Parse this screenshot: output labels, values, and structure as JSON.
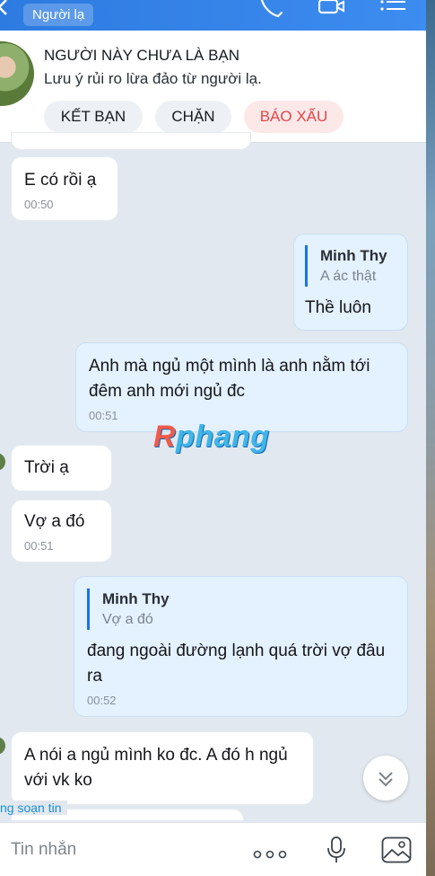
{
  "header": {
    "tag": "Người lạ"
  },
  "stranger_card": {
    "title": "NGƯỜI NÀY CHƯA LÀ BẠN",
    "warning": "Lưu ý rủi ro lừa đảo từ người lạ.",
    "actions": {
      "add_friend": "KẾT BẠN",
      "block": "CHẶN",
      "report": "BÁO XẤU"
    }
  },
  "messages": [
    {
      "text": "E có rồi ạ",
      "time": "00:50"
    },
    {
      "quote_name": "Minh Thy",
      "quote_text": "A ác thật",
      "text": "Thề luôn"
    },
    {
      "text": "Anh mà ngủ một mình là anh nằm tới đêm anh mới ngủ đc",
      "time": "00:51"
    },
    {
      "text": "Trời ạ"
    },
    {
      "text": "Vợ a đó",
      "time": "00:51"
    },
    {
      "quote_name": "Minh Thy",
      "quote_text": "Vợ a đó",
      "text": "đang ngoài đường lạnh quá trời vợ đâu ra",
      "time": "00:52"
    },
    {
      "text": "A nói a ngủ mình ko đc. A đó h ngủ với vk ko"
    }
  ],
  "watermark": {
    "prefix": "R",
    "rest": "phang"
  },
  "typing_indicator": "ng soạn tin",
  "composer": {
    "placeholder": "Tin nhắn"
  },
  "colors": {
    "header": "#2d7be0",
    "outgoing_bubble": "#e4f1ff",
    "report": "#e0474c",
    "chat_bg": "#e2e8ef"
  }
}
